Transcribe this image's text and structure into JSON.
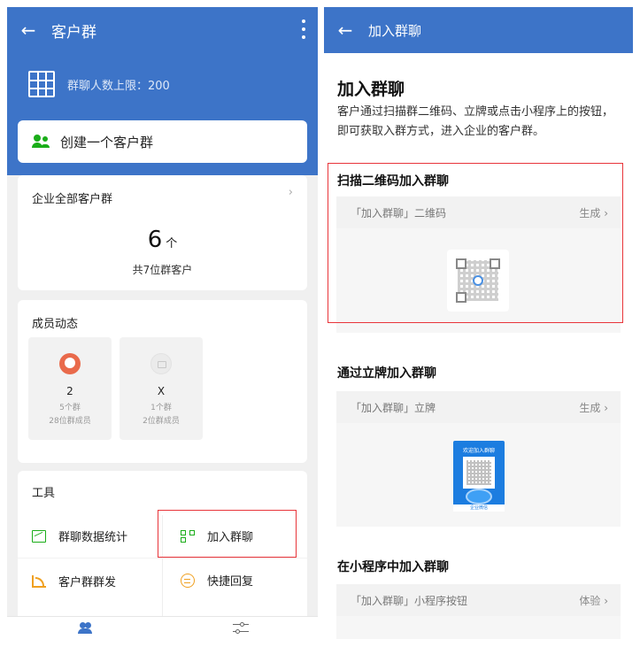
{
  "left": {
    "topbar": {
      "back": "←",
      "title": "客户群",
      "more": "⋮"
    },
    "group_limit": "群聊人数上限：200",
    "create_group": "创建一个客户群",
    "all_groups": {
      "title": "企业全部客户群",
      "chevron": "›",
      "count": "6",
      "unit": "个",
      "subtitle": "共7位群客户"
    },
    "members": {
      "title": "成员动态",
      "items": [
        {
          "name": "2",
          "groups": "5个群",
          "members": "28位群成员"
        },
        {
          "name": "X",
          "groups": "1个群",
          "members": "2位群成员"
        }
      ]
    },
    "tools": {
      "title": "工具",
      "items": [
        {
          "label": "群聊数据统计",
          "icon": "chart-icon"
        },
        {
          "label": "加入群聊",
          "icon": "qrcode-icon"
        },
        {
          "label": "客户群群发",
          "icon": "broadcast-icon"
        },
        {
          "label": "快捷回复",
          "icon": "chat-icon"
        }
      ]
    },
    "tabbar": {
      "items": [
        "contacts-icon",
        "settings-icon"
      ]
    }
  },
  "right": {
    "topbar": {
      "back": "←",
      "title": "加入群聊"
    },
    "heading": "加入群聊",
    "description": "客户通过扫描群二维码、立牌或点击小程序上的按钮，即可获取入群方式，进入企业的客户群。",
    "sections": [
      {
        "title": "扫描二维码加入群聊",
        "panel_label": "「加入群聊」二维码",
        "action": "生成 ›"
      },
      {
        "title": "通过立牌加入群聊",
        "panel_label": "「加入群聊」立牌",
        "action": "生成 ›",
        "poster": {
          "title": "欢迎加入群聊",
          "footer": "企业微信"
        }
      },
      {
        "title": "在小程序中加入群聊",
        "panel_label": "「加入群聊」小程序按钮",
        "action": "体验 ›"
      }
    ]
  },
  "colors": {
    "primary": "#3d74c8",
    "highlight": "#e8353a",
    "green": "#1aad19",
    "orange": "#f0a020"
  }
}
